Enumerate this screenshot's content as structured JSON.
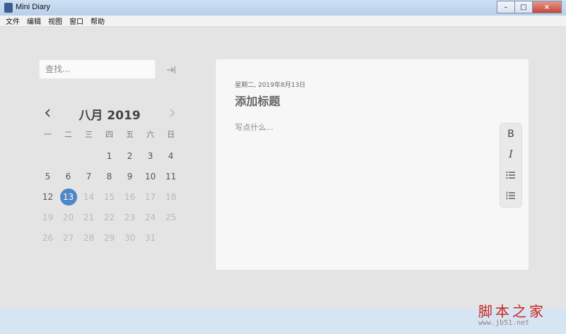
{
  "window": {
    "title": "Mini Diary",
    "minimize": "–",
    "maximize": "□",
    "close": "×"
  },
  "menu": [
    "文件",
    "编辑",
    "视图",
    "窗口",
    "帮助"
  ],
  "search": {
    "placeholder": "查找..."
  },
  "calendar": {
    "title": "八月 2019",
    "weekdays": [
      "一",
      "二",
      "三",
      "四",
      "五",
      "六",
      "日"
    ],
    "weeks": [
      [
        "",
        "",
        "",
        "1",
        "2",
        "3",
        "4"
      ],
      [
        "5",
        "6",
        "7",
        "8",
        "9",
        "10",
        "11"
      ],
      [
        "12",
        "13",
        "14",
        "15",
        "16",
        "17",
        "18"
      ],
      [
        "19",
        "20",
        "21",
        "22",
        "23",
        "24",
        "25"
      ],
      [
        "26",
        "27",
        "28",
        "29",
        "30",
        "31",
        ""
      ]
    ],
    "selected_day": "13"
  },
  "editor": {
    "date": "星期二, 2019年8月13日",
    "title_placeholder": "添加标题",
    "body_placeholder": "写点什么..."
  },
  "toolbar": {
    "bold_label": "B",
    "italic_label": "I"
  },
  "watermark": {
    "text": "脚本之家",
    "url": "www.jb51.net"
  },
  "colors": {
    "accent": "#4d86c9",
    "watermark": "#c8251e"
  }
}
